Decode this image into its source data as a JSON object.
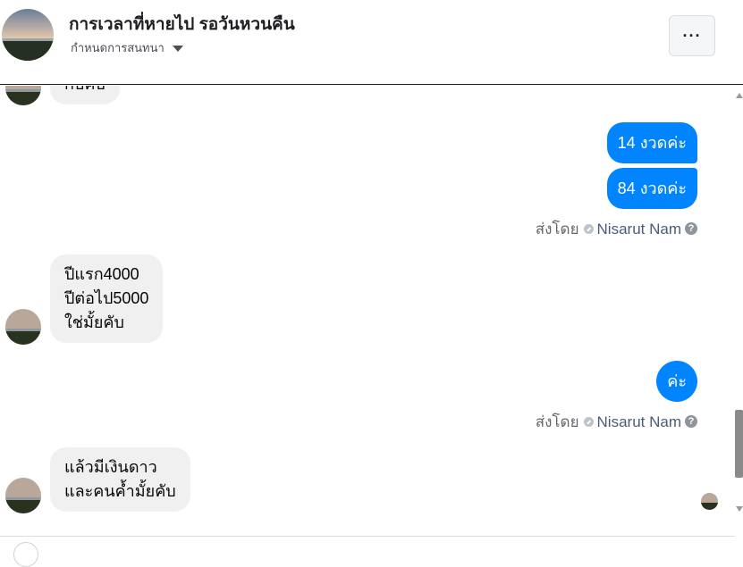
{
  "conversation": {
    "title": "การเวลาที่หายไป รอวันหวนคืน",
    "settings_label": "กำหนดการสนทนา",
    "more_button": "···"
  },
  "messages": [
    {
      "side": "in",
      "lines": [
        "กับคับ"
      ]
    },
    {
      "side": "out",
      "text": "14 งวดค่ะ"
    },
    {
      "side": "out",
      "text": "84 งวดค่ะ"
    },
    {
      "side": "in",
      "lines": [
        "ปีแรก4000",
        "ปีต่อไป5000",
        "ใช่มั้ยคับ"
      ]
    },
    {
      "side": "out",
      "text": "ค่ะ"
    },
    {
      "side": "in",
      "lines": [
        "แล้วมีเงินดาว",
        "และคนค้ำมั้ยคับ"
      ]
    }
  ],
  "sent_by": {
    "prefix": "ส่งโดย",
    "name": "Nisarut Nam",
    "help": "?"
  },
  "colors": {
    "outgoing_bubble": "#0084ff",
    "incoming_bubble": "#f0f0f0",
    "sent_by_name": "#4b5c7a"
  },
  "icons": [
    "more-icon",
    "caret-down-icon",
    "check-circle-icon",
    "help-icon",
    "scroll-up-icon",
    "scroll-down-icon"
  ]
}
